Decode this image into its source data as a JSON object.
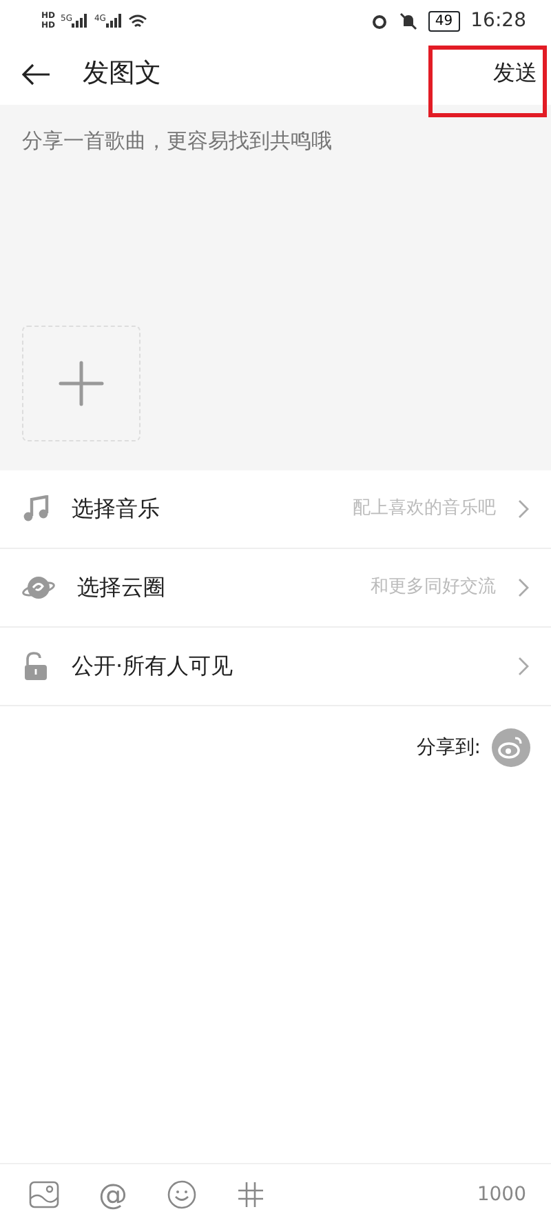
{
  "status_bar": {
    "sim_labels": [
      "HD",
      "HD"
    ],
    "networks": [
      "5G",
      "4G"
    ],
    "battery": "49",
    "time": "16:28"
  },
  "header": {
    "title": "发图文",
    "send": {
      "label": "发送",
      "highlighted": true
    }
  },
  "composer": {
    "placeholder": "分享一首歌曲，更容易找到共鸣哦"
  },
  "options": [
    {
      "kind": "music",
      "label": "选择音乐",
      "hint": "配上喜欢的音乐吧"
    },
    {
      "kind": "circle",
      "label": "选择云圈",
      "hint": "和更多同好交流"
    },
    {
      "kind": "privacy",
      "label": "公开·所有人可见"
    }
  ],
  "share": {
    "label": "分享到:"
  },
  "toolbar": [
    {
      "kind": "image"
    },
    {
      "kind": "text",
      "label": "@"
    },
    {
      "kind": "emoji"
    },
    {
      "kind": "hashtag"
    }
  ],
  "counter": "1000"
}
